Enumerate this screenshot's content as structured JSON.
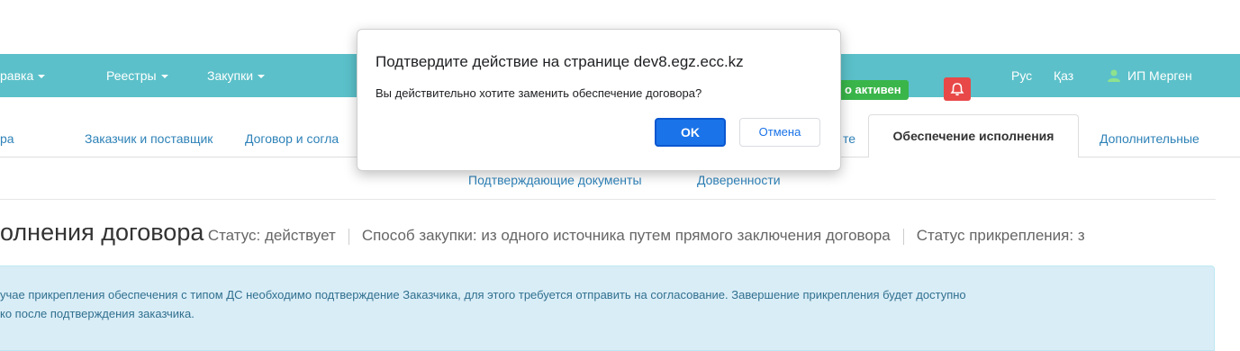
{
  "navbar": {
    "items": [
      "равка",
      "Реестры",
      "Закупки"
    ],
    "status_badge": "о активен",
    "lang_ru": "Рус",
    "lang_kz": "Қаз",
    "user": "ИП Мерген"
  },
  "tabs": {
    "items": [
      "ра",
      "Заказчик и поставщик",
      "Договор и согла",
      "те"
    ],
    "active": "Обеспечение исполнения",
    "more": "Дополнительные"
  },
  "subtabs": [
    "Подтверждающие документы",
    "Доверенности"
  ],
  "page": {
    "title": "олнения договора",
    "status": "Статус: действует",
    "method": "Способ закупки: из одного источника путем прямого заключения договора",
    "attach_status": "Статус прикрепления: з"
  },
  "alert": {
    "line1": "учае прикрепления обеспечения с типом ДС необходимо подтверждение Заказчика, для этого требуется отправить на согласование. Завершение прикрепления будет доступно",
    "line2": "ко после подтверждения заказчика."
  },
  "dialog": {
    "title": "Подтвердите действие на странице dev8.egz.ecc.kz",
    "message": "Вы действительно хотите заменить обеспечение договора?",
    "ok": "OK",
    "cancel": "Отмена"
  },
  "icons": [
    "caret-down-icon",
    "bell-icon",
    "user-icon"
  ],
  "colors": {
    "navbar": "#5bc0c9",
    "badge": "#3ab54a",
    "bell": "#e84848",
    "link": "#2e82b8",
    "alert_bg": "#d9edf7",
    "primary": "#1a73e8"
  }
}
